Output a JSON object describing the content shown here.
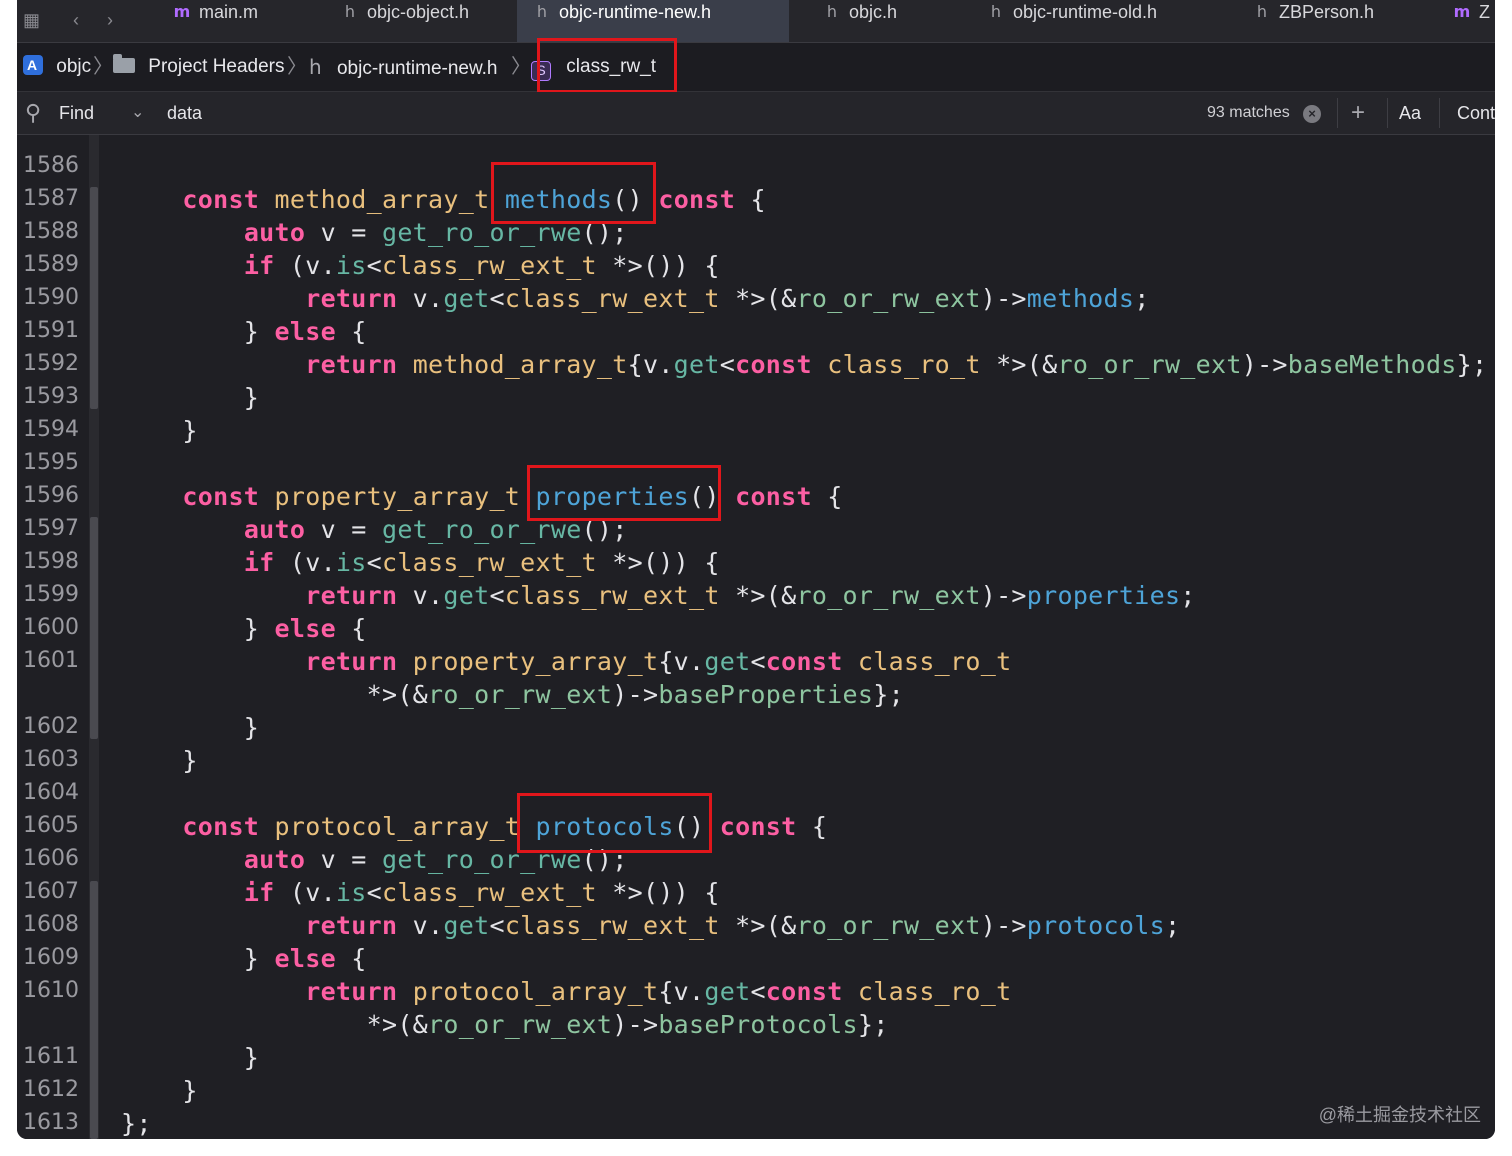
{
  "tabs": [
    {
      "icon": "m",
      "label": "main.m",
      "active": false,
      "italic": false
    },
    {
      "icon": "h",
      "label": "objc-object.h",
      "active": false,
      "italic": false
    },
    {
      "icon": "h",
      "label": "objc-runtime-new.h",
      "active": true,
      "italic": false
    },
    {
      "icon": "h",
      "label": "objc.h",
      "active": false,
      "italic": false
    },
    {
      "icon": "h",
      "label": "objc-runtime-old.h",
      "active": false,
      "italic": true
    },
    {
      "icon": "h",
      "label": "ZBPerson.h",
      "active": false,
      "italic": false
    },
    {
      "icon": "m",
      "label": "Z",
      "active": false,
      "italic": false
    }
  ],
  "jumpbar": {
    "project": "objc",
    "group": "Project Headers",
    "file_icon": "h",
    "file": "objc-runtime-new.h",
    "symbol_icon": "S",
    "symbol": "class_rw_t"
  },
  "find": {
    "mode": "Find",
    "query": "data",
    "matches": "93 matches",
    "add": "+",
    "case": "Aa",
    "contains": "Cont"
  },
  "editor": {
    "line_numbers": [
      "1586",
      "1587",
      "1588",
      "1589",
      "1590",
      "1591",
      "1592",
      "1593",
      "1594",
      "1595",
      "1596",
      "1597",
      "1598",
      "1599",
      "1600",
      "1601",
      "1602",
      "1603",
      "1604",
      "1605",
      "1606",
      "1607",
      "1608",
      "1609",
      "1610",
      "1611",
      "1612",
      "1613"
    ],
    "lines": [
      "",
      "    const method_array_t methods() const {",
      "        auto v = get_ro_or_rwe();",
      "        if (v.is<class_rw_ext_t *>()) {",
      "            return v.get<class_rw_ext_t *>(&ro_or_rw_ext)->methods;",
      "        } else {",
      "            return method_array_t{v.get<const class_ro_t *>(&ro_or_rw_ext)->baseMethods};",
      "        }",
      "    }",
      "",
      "    const property_array_t properties() const {",
      "        auto v = get_ro_or_rwe();",
      "        if (v.is<class_rw_ext_t *>()) {",
      "            return v.get<class_rw_ext_t *>(&ro_or_rw_ext)->properties;",
      "        } else {",
      "            return property_array_t{v.get<const class_ro_t",
      "                *>(&ro_or_rw_ext)->baseProperties};",
      "        }",
      "    }",
      "",
      "    const protocol_array_t protocols() const {",
      "        auto v = get_ro_or_rwe();",
      "        if (v.is<class_rw_ext_t *>()) {",
      "            return v.get<class_rw_ext_t *>(&ro_or_rw_ext)->protocols;",
      "        } else {",
      "            return protocol_array_t{v.get<const class_ro_t",
      "                *>(&ro_or_rw_ext)->baseProtocols};",
      "        }",
      "    }",
      "};"
    ]
  },
  "watermark": "@稀土掘金技术社区",
  "colors": {
    "keyword": "#fc5fa3",
    "type": "#e9c07e",
    "function": "#67b7a4",
    "highlight_box": "#e0161b",
    "background": "#1f1f24"
  }
}
